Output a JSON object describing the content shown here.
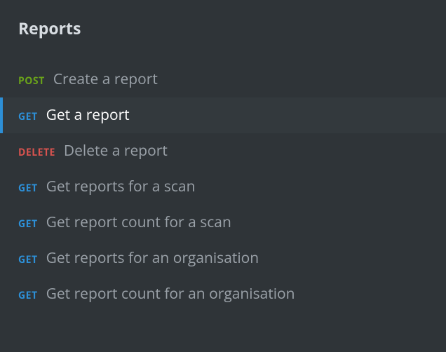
{
  "section": {
    "title": "Reports"
  },
  "items": [
    {
      "method": "POST",
      "label": "Create a report"
    },
    {
      "method": "GET",
      "label": "Get a report"
    },
    {
      "method": "DELETE",
      "label": "Delete a report"
    },
    {
      "method": "GET",
      "label": "Get reports for a scan"
    },
    {
      "method": "GET",
      "label": "Get report count for a scan"
    },
    {
      "method": "GET",
      "label": "Get reports for an organisation"
    },
    {
      "method": "GET",
      "label": "Get report count for an organisation"
    }
  ],
  "active_index": 1
}
